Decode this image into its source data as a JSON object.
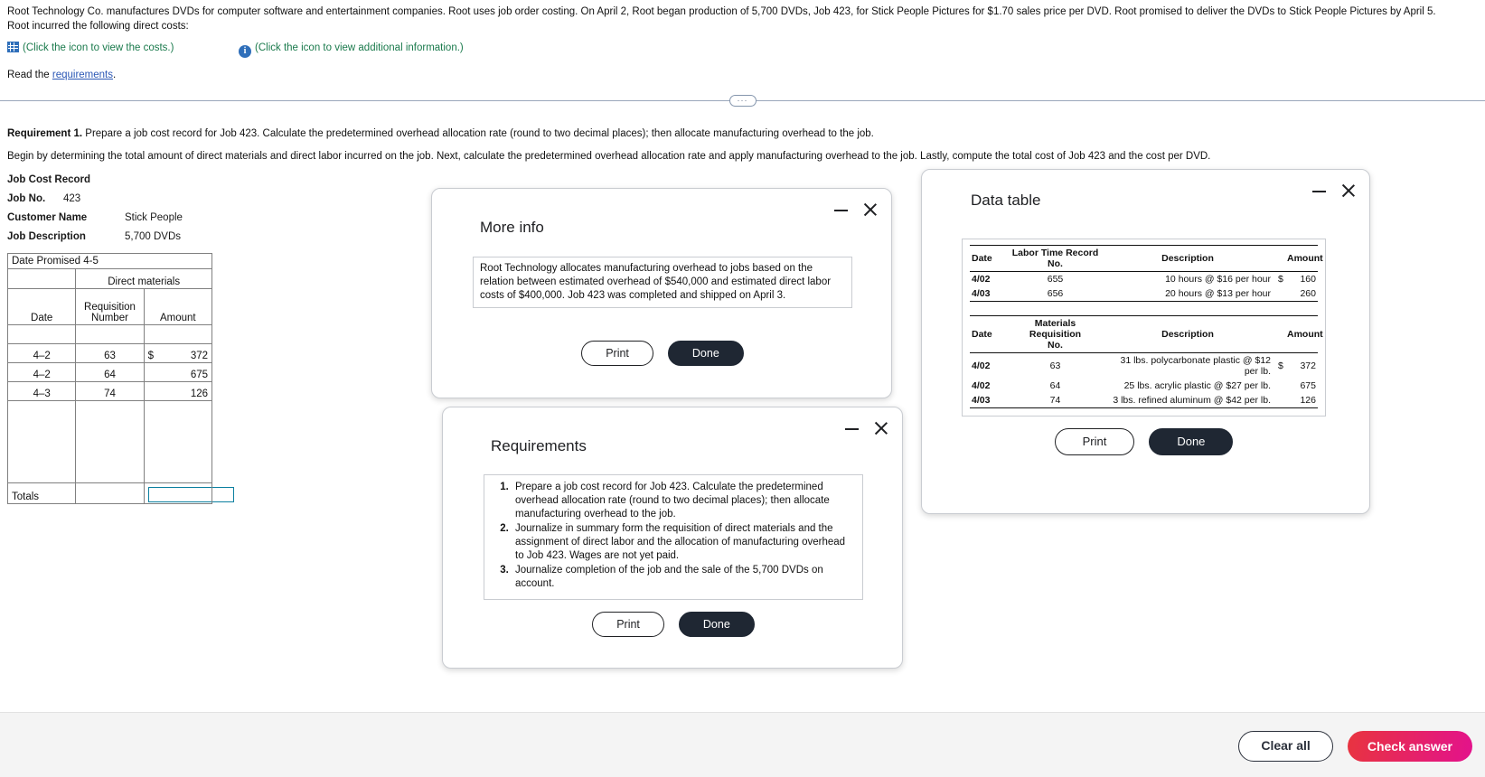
{
  "problem": {
    "paragraph1": "Root Technology Co. manufactures DVDs for computer software and entertainment companies. Root uses job order costing. On April 2, Root began production of 5,700 DVDs, Job 423, for Stick People Pictures for $1.70 sales price per DVD. Root promised to deliver the DVDs to Stick People Pictures by April 5.",
    "paragraph2": "Root incurred the following direct costs:",
    "costs_link": "(Click the icon to view the costs.)",
    "info_link": "(Click the icon to view additional information.)",
    "read_prefix": "Read the ",
    "read_link": "requirements",
    "read_suffix": ".",
    "divider_handle": "···"
  },
  "requirement_section": {
    "label": "Requirement 1.",
    "text": " Prepare a job cost record for Job 423. Calculate the predetermined overhead allocation rate (round to two decimal places); then allocate manufacturing overhead to the job.",
    "hint": "Begin by determining the total amount of direct materials and direct labor incurred on the job. Next, calculate the predetermined overhead allocation rate and apply manufacturing overhead to the job. Lastly, compute the total cost of Job 423 and the cost per DVD."
  },
  "job_cost_record": {
    "title": "Job Cost Record",
    "job_no_label": "Job No.",
    "job_no_value": "423",
    "customer_label": "Customer Name",
    "customer_value": "Stick People",
    "description_label": "Job Description",
    "description_value": "5,700 DVDs",
    "date_promised": "Date Promised 4-5",
    "group_header": "Direct materials",
    "col_date": "Date",
    "col_req_line1": "Requisition",
    "col_req_line2": "Number",
    "col_amount": "Amount",
    "rows": [
      {
        "date": "4–2",
        "requisition": "63",
        "currency": "$",
        "amount": "372"
      },
      {
        "date": "4–2",
        "requisition": "64",
        "currency": "",
        "amount": "675"
      },
      {
        "date": "4–3",
        "requisition": "74",
        "currency": "",
        "amount": "126"
      }
    ],
    "totals_label": "Totals",
    "totals_amount_value": ""
  },
  "more_info_dialog": {
    "title": "More info",
    "body": "Root Technology allocates manufacturing overhead to jobs based on the relation between estimated overhead of $540,000 and estimated direct labor costs of $400,000. Job 423 was completed and shipped on April 3.",
    "print_label": "Print",
    "done_label": "Done"
  },
  "requirements_dialog": {
    "title": "Requirements",
    "items": [
      "Prepare a job cost record for Job 423. Calculate the predetermined overhead allocation rate (round to two decimal places); then allocate manufacturing overhead to the job.",
      "Journalize in summary form the requisition of direct materials and the assignment of direct labor and the allocation of manufacturing overhead to Job 423. Wages are not yet paid.",
      "Journalize completion of the job and the sale of the 5,700 DVDs on account."
    ],
    "print_label": "Print",
    "done_label": "Done"
  },
  "data_table_dialog": {
    "title": "Data table",
    "labor": {
      "col_date": "Date",
      "col_record_no": "Labor Time Record No.",
      "col_description": "Description",
      "col_amount": "Amount",
      "rows": [
        {
          "date": "4/02",
          "record_no": "655",
          "description": "10 hours @ $16 per hour",
          "currency": "$",
          "amount": "160"
        },
        {
          "date": "4/03",
          "record_no": "656",
          "description": "20 hours @ $13 per hour",
          "currency": "",
          "amount": "260"
        }
      ]
    },
    "materials": {
      "col_date": "Date",
      "col_req_line1": "Materials",
      "col_req_line2": "Requisition",
      "col_req_line3": "No.",
      "col_description": "Description",
      "col_amount": "Amount",
      "rows": [
        {
          "date": "4/02",
          "req_no": "63",
          "description": "31 lbs. polycarbonate plastic @ $12 per lb.",
          "currency": "$",
          "amount": "372"
        },
        {
          "date": "4/02",
          "req_no": "64",
          "description": "25 lbs. acrylic plastic @ $27 per lb.",
          "currency": "",
          "amount": "675"
        },
        {
          "date": "4/03",
          "req_no": "74",
          "description": "3 lbs. refined aluminum @ $42 per lb.",
          "currency": "",
          "amount": "126"
        }
      ]
    },
    "print_label": "Print",
    "done_label": "Done"
  },
  "bottom_bar": {
    "clear_all_label": "Clear all",
    "check_answer_label": "Check answer"
  },
  "colors": {
    "link_green": "#1a7a4c",
    "link_blue": "#2b57b5",
    "accent_input": "#0b7fa0",
    "check_answer_start": "#e8343f",
    "check_answer_end": "#e3128c",
    "done_button": "#1f2733"
  }
}
